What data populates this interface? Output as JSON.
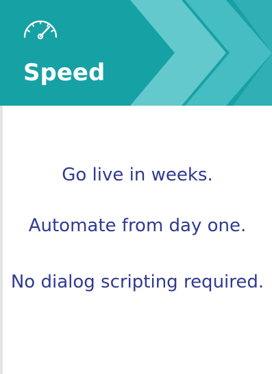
{
  "header": {
    "icon": "speedometer-icon",
    "title": "Speed",
    "colors": {
      "background": "#16a1a5",
      "chevron_light": "#72d0d3",
      "chevron_mid": "#4bbfc3",
      "text": "#ffffff"
    }
  },
  "body": {
    "lines": [
      "Go live in weeks.",
      "Automate from day one.",
      "No dialog scripting required."
    ],
    "text_color": "#2f3a8f"
  }
}
